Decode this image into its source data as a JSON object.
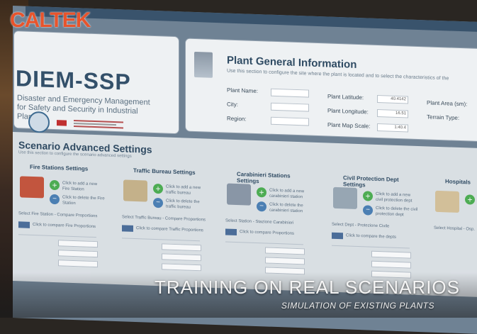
{
  "brand": {
    "logo_text": "CALTEK",
    "app_name": "DIEM-SSP",
    "subtitle": "Disaster and Emergency Management for Safety and Security in Industrial Plants"
  },
  "plant_info": {
    "title": "Plant General Information",
    "description": "Use this section to configure the site where the plant is located and to select the characteristics of the",
    "fields": {
      "plant_name_label": "Plant Name:",
      "city_label": "City:",
      "region_label": "Region:",
      "latitude_label": "Plant Latitude:",
      "latitude_value": "40.4142",
      "longitude_label": "Plant Longitude:",
      "longitude_value": "16.51",
      "map_scale_label": "Plant Map Scale:",
      "map_scale_value": "1:40.4",
      "area_label": "Plant Area (sm):",
      "terrain_label": "Terrain Type:"
    }
  },
  "advanced": {
    "title": "Scenario Advanced Settings",
    "subtitle": "Use this section to configure the scenario advanced settings",
    "columns": [
      {
        "title": "Fire Stations Settings",
        "add": "Click to add a new Fire Station",
        "del": "Click to delete the Fire Station",
        "select": "Select Fire Station - Compare Proportions",
        "summary": "Click to compare Fire Proportions"
      },
      {
        "title": "Traffic Bureau Settings",
        "add": "Click to add a new traffic bureau",
        "del": "Click to delete the traffic bureau",
        "select": "Select Traffic Bureau - Compare Proportions",
        "summary": "Click to compare Traffic Proportions"
      },
      {
        "title": "Carabinieri Stations Settings",
        "add": "Click to add a new carabinieri station",
        "del": "Click to delete the carabinieri station",
        "select": "Select Station - Stazione Carabinieri",
        "summary": "Click to compare Proportions"
      },
      {
        "title": "Civil Protection Dept Settings",
        "add": "Click to add a new civil protection dept",
        "del": "Click to delete the civil protection dept",
        "select": "Select Dept - Protezione Civile",
        "summary": "Click to compare the depts"
      },
      {
        "title": "Hospitals",
        "add": "",
        "del": "",
        "select": "Select Hospital - Osp.",
        "summary": ""
      }
    ]
  },
  "caption": {
    "main": "TRAINING ON REAL SCENARIOS",
    "sub": "SIMULATION OF EXISTING PLANTS"
  }
}
